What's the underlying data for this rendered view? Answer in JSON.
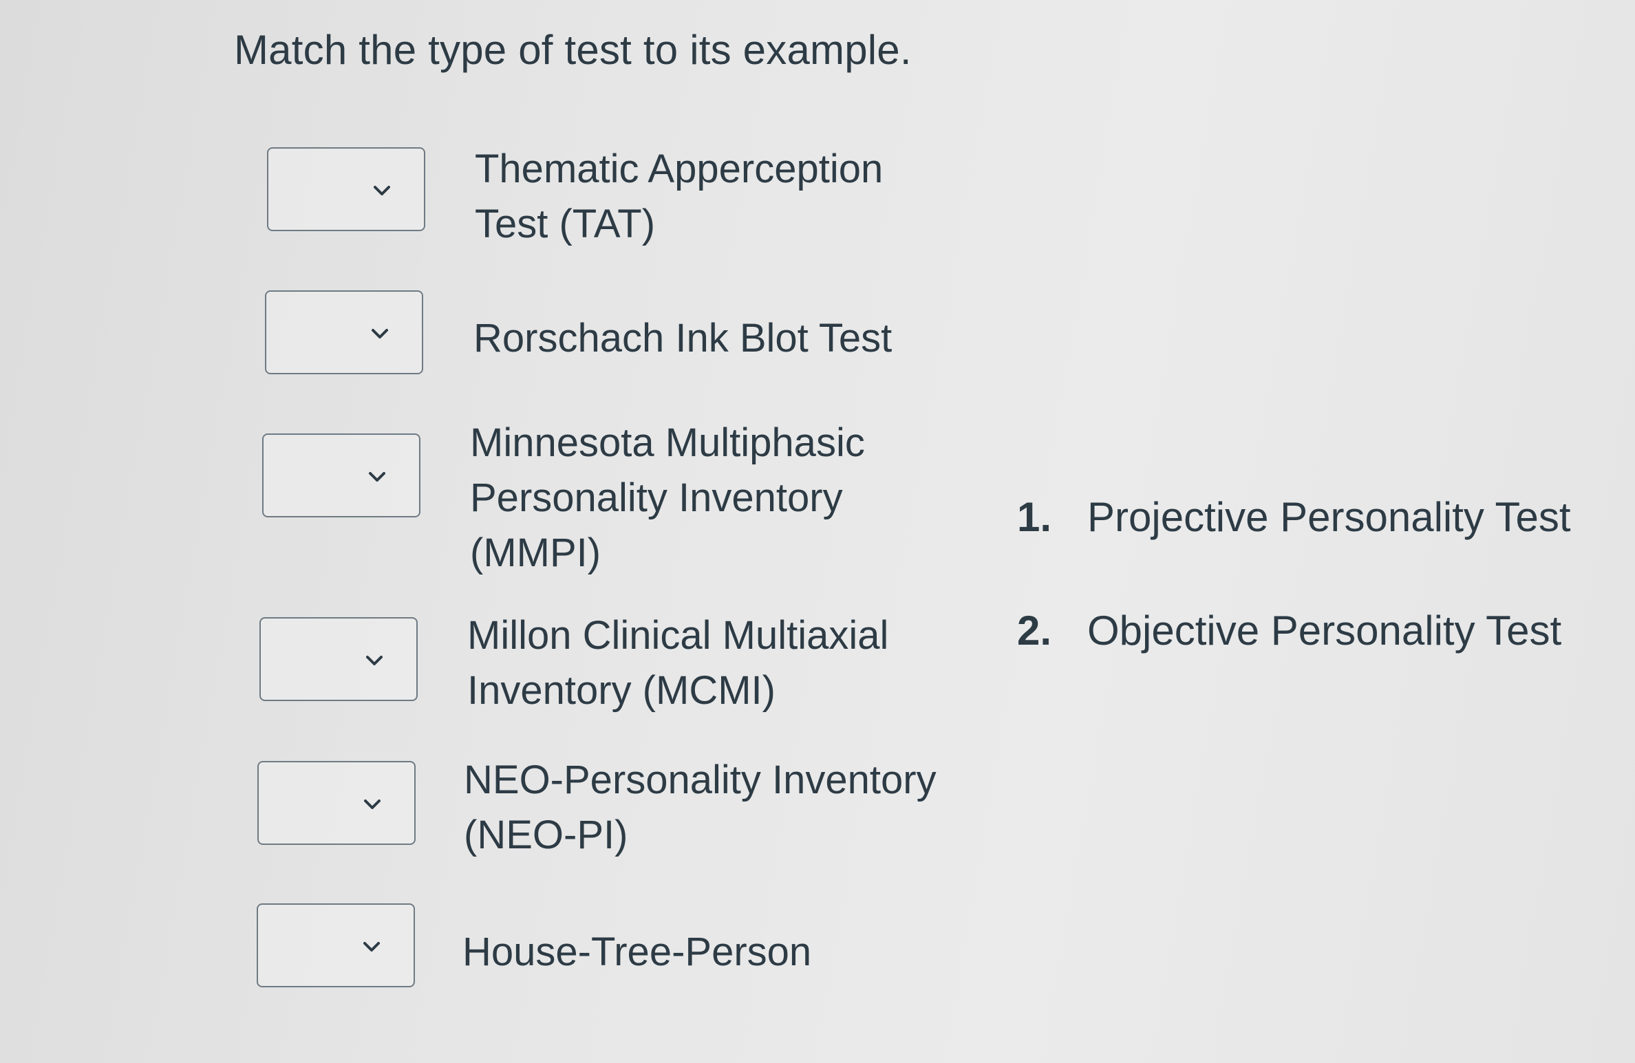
{
  "question": "Match the type of test to its example.",
  "items": [
    {
      "label": "Thematic Apperception\nTest (TAT)",
      "selected": ""
    },
    {
      "label": "Rorschach Ink Blot Test",
      "selected": ""
    },
    {
      "label": "Minnesota Multiphasic\nPersonality Inventory\n(MMPI)",
      "selected": ""
    },
    {
      "label": "Millon Clinical Multiaxial\nInventory (MCMI)",
      "selected": ""
    },
    {
      "label": "NEO-Personality Inventory\n(NEO-PI)",
      "selected": ""
    },
    {
      "label": "House-Tree-Person",
      "selected": ""
    }
  ],
  "answers": [
    {
      "number": "1.",
      "label": "Projective Personality Test"
    },
    {
      "number": "2.",
      "label": "Objective Personality Test"
    }
  ],
  "icons": {
    "dropdown": "chevron-down-icon"
  },
  "colors": {
    "text": "#2d3b45",
    "border": "#6f7a83"
  }
}
